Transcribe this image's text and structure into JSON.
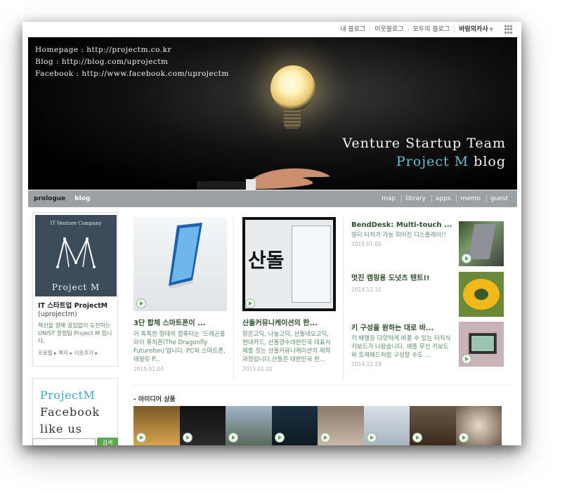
{
  "topbar": {
    "items": [
      "내 블로그",
      "이웃블로그",
      "모두의 블로그",
      "바람의카사"
    ]
  },
  "banner": {
    "homepage": "Homepage : http://projectm.co.kr",
    "blog": "Blog : http://blog.com/uprojectm",
    "facebook": "Facebook : http://www.facebook.com/uprojectm",
    "tagline1": "Venture Startup Team",
    "tagline2_project": "Project M",
    "tagline2_blog": "blog",
    "accent": "#5fc3d8"
  },
  "nav": {
    "left": [
      "prologue",
      "blog"
    ],
    "right": [
      "map",
      "library",
      "apps",
      "memo",
      "guest"
    ]
  },
  "profile": {
    "logo_company": "IT Venture Company",
    "logo_name": "Project M",
    "name": "IT 스타트업 ProjectM",
    "handle": "(uprojectm)",
    "desc": "혁신을 향해 끊임없이 도전하는 UNIST 창업팀 Project M 입니다.",
    "links": "프로필 ▸ 쪽지 ▸ 이웃추가 ▸"
  },
  "facebook_card": {
    "line1": "ProjectM",
    "line2": "Facebook",
    "line3": "like us"
  },
  "search": {
    "button": "검색"
  },
  "posts": [
    {
      "title": "3단 합체 스마트폰이 ...",
      "excerpt": "이 독특한 형태의 컴퓨터는 '드래곤플라이 퓨처폰(The Dragonfly Futurefon)'입니다. PC와 스마트폰, 태블릿 P...",
      "date": "2015.01.03"
    },
    {
      "title": "산돌커뮤니케이션의 한...",
      "excerpt": "맑은고딕, 나눔고딕, 산돌네오고딕, 현대카드, 산돌광수대한민국 대표서체를 짓는 산돌커뮤니케이션의 제작과정입니다.산돌은 대한민국 한...",
      "date": "2015.01.02",
      "thumb_text": "산돌"
    }
  ],
  "side_posts": [
    {
      "title": "BendDesk: Multi-touch ...",
      "excerpt": "멀티 터치가 가능 휘어진 디스플레이!!",
      "date": "2015.01.02"
    },
    {
      "title": "멋진 캠핑용 도넛츠 텐트!!",
      "excerpt": "",
      "date": "2014.12.31"
    },
    {
      "title": "키 구성을 원하는 대로 바...",
      "excerpt": "키 배열을 다양하게 바꿀 수 있는 터치식 키보드가 나왔습니다. 애플 무선 키보드와 트랙패드처럼 구성할 수도 ...",
      "date": "2014.12.29"
    }
  ],
  "idea_section": {
    "title": "- 아이디어 상품"
  }
}
